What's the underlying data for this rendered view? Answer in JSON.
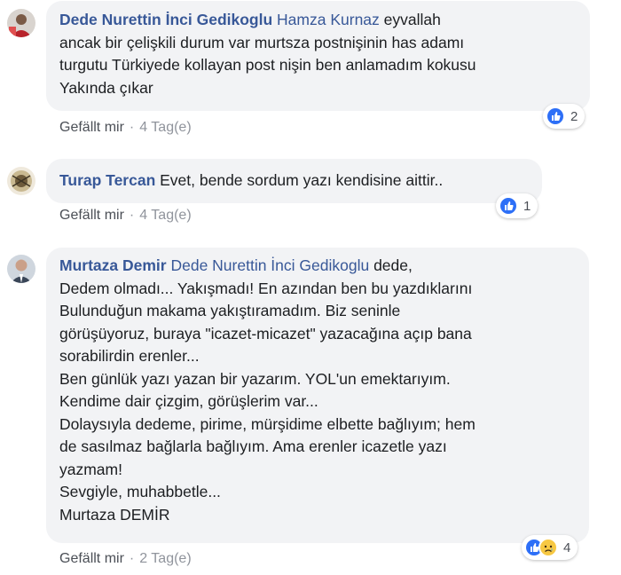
{
  "comments": [
    {
      "author": "Dede Nurettin İnci Gedikoglu",
      "mention": "Hamza Kurnaz",
      "lines": [
        " eyvallah",
        "ancak bir çelişkili durum var murtsza postnişinin has adamı",
        "turgutu Türkiyede kollayan post nişin ben anlamadım kokusu",
        "Yakında çıkar"
      ],
      "like_label": "Gefällt mir",
      "time": "4 Tag(e)",
      "reaction_count": "2"
    },
    {
      "author": "Turap Tercan",
      "lines": [
        " Evet, bende sordum yazı kendisine aittir.."
      ],
      "like_label": "Gefällt mir",
      "time": "4 Tag(e)",
      "reaction_count": "1"
    },
    {
      "author": "Murtaza Demir",
      "mention": "Dede Nurettin İnci Gedikoglu",
      "lines": [
        " dede,",
        "Dedem olmadı... Yakışmadı! En azından ben bu yazdıklarını",
        "Bulunduğun makama yakıştıramadım. Biz seninle",
        "görüşüyoruz, buraya \"icazet-micazet\" yazacağına açıp bana",
        "sorabilirdin erenler...",
        "Ben günlük yazı yazan bir yazarım. YOL'un emektarıyım.",
        "Kendime dair çizgim, görüşlerim var...",
        "Dolaysıyla dedeme, pirime, mürşidime elbette bağlıyım; hem",
        "de sasılmaz bağlarla bağlıyım. Ama erenler icazetle yazı",
        "yazmam!",
        "Sevgiyle, muhabbetle...",
        "Murtaza DEMİR"
      ],
      "like_label": "Gefällt mir",
      "time": "2 Tag(e)",
      "reaction_count": "4"
    }
  ],
  "separator": "·",
  "icons": {
    "like": "like-reaction-icon",
    "sad": "sad-reaction-icon"
  },
  "colors": {
    "name": "#385898",
    "bubble": "#f2f3f5",
    "meta": "#90949c",
    "like_blue": "#2d6ff7",
    "sad_yellow": "#f7c843"
  }
}
